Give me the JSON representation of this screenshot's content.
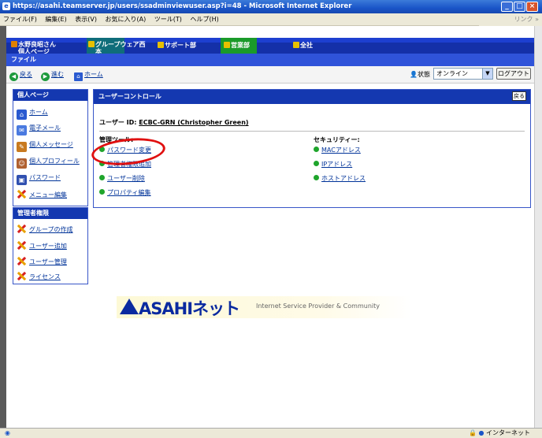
{
  "window": {
    "title": "https://asahi.teamserver.jp/users/ssadminviewuser.asp?i=48 - Microsoft Internet Explorer",
    "menu": [
      "ファイル(F)",
      "編集(E)",
      "表示(V)",
      "お気に入り(A)",
      "ツール(T)",
      "ヘルプ(H)"
    ],
    "links_label": "リンク »",
    "status_zone": "インターネット"
  },
  "topnav": {
    "user_name": "水野良昭さん",
    "user_page": "個人ページ",
    "tabs": [
      "グループウェア西",
      "サポート部",
      "営業部",
      "全社"
    ],
    "tab_suffix": "本",
    "file_label": "ファイル"
  },
  "toolbar": {
    "back": "戻る",
    "forward": "進む",
    "home": "ホーム",
    "status_label": "状態",
    "status_value": "オンライン",
    "logout": "ログアウト"
  },
  "sidebar": {
    "personal_title": "個人ページ",
    "items": [
      "ホーム",
      "電子メール",
      "個人メッセージ",
      "個人プロフィール",
      "パスワード",
      "メニュー編集"
    ],
    "admin_title": "管理者権限",
    "admin_items": [
      "グループの作成",
      "ユーザー追加",
      "ユーザー管理",
      "ライセンス"
    ]
  },
  "main": {
    "title": "ユーザーコントロール",
    "back_button": "戻る",
    "user_prefix": "ユーザー ID:",
    "user_id": "ECBC-GRN (Christopher Green)",
    "management_title": "管理ツール:",
    "management_links": [
      "パスワード変更",
      "管理者権限追加",
      "ユーザー削除",
      "プロパティ編集"
    ],
    "security_title": "セキュリティー:",
    "security_links": [
      "MACアドレス",
      "IPアドレス",
      "ホストアドレス"
    ]
  },
  "logo": {
    "name": "ASAHIネット",
    "tagline": "Internet Service Provider & Community"
  },
  "colors": {
    "nav_blue": "#1430a8",
    "panel_head": "#1438b0",
    "highlight_circle": "#e01010",
    "link": "#003399"
  }
}
